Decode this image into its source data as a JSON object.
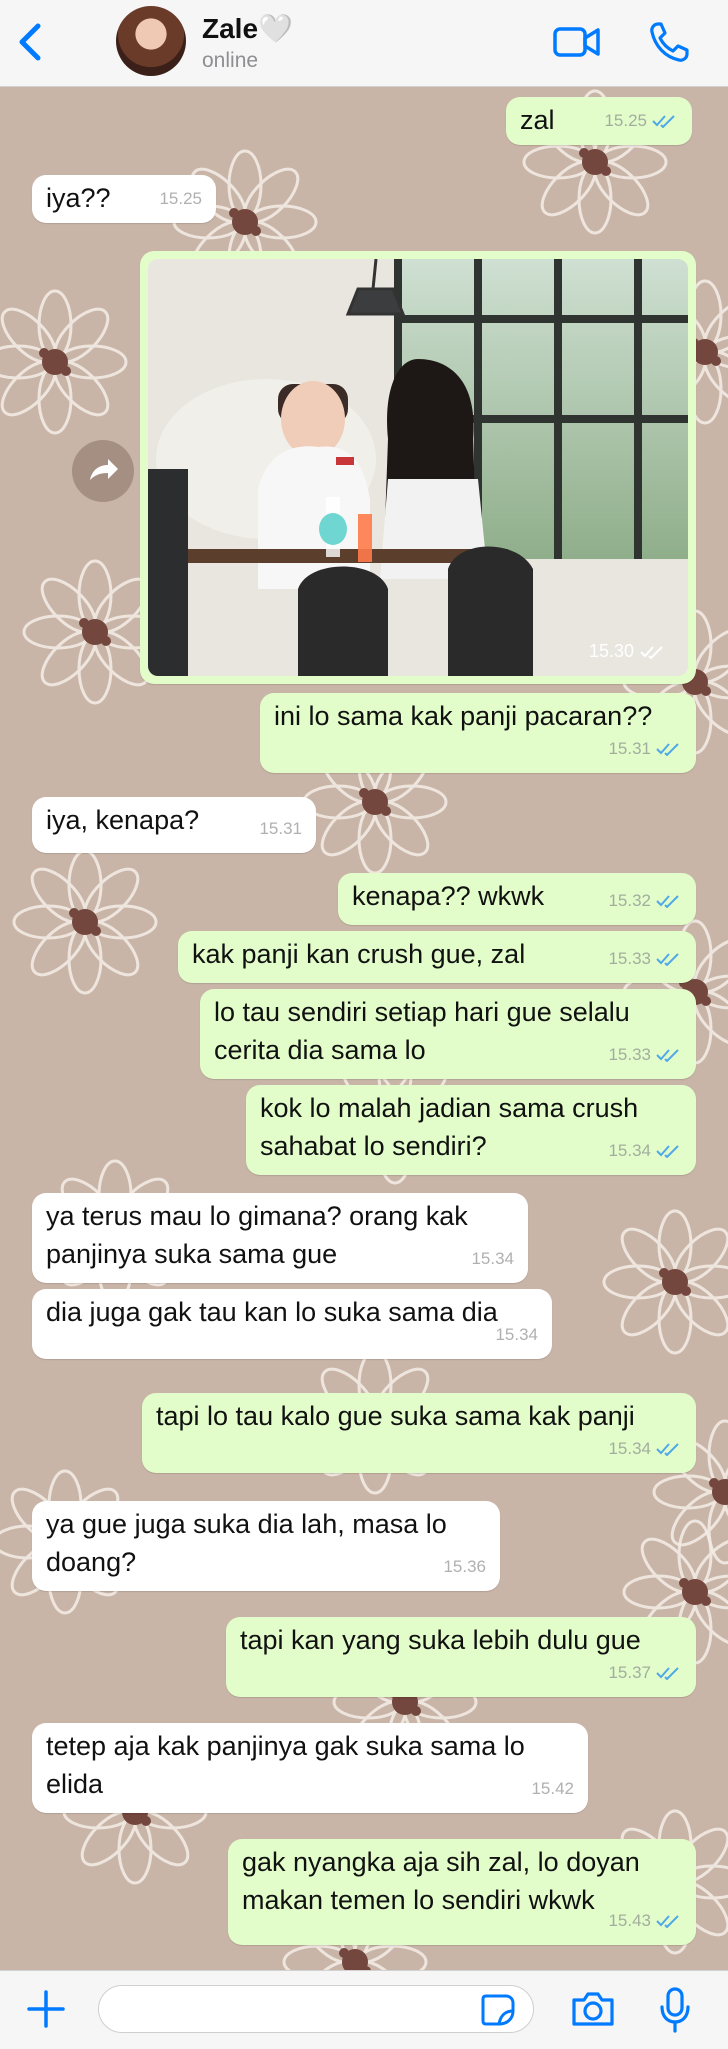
{
  "header": {
    "contact_name": "Zale🤍",
    "status": "online",
    "icons": [
      "back-arrow-icon",
      "video-call-icon",
      "phone-call-icon"
    ],
    "accent_color": "#007aff"
  },
  "photo_message": {
    "time": "15.30",
    "icons": [
      "forward-icon",
      "read-ticks-icon"
    ]
  },
  "messages": [
    {
      "dir": "out",
      "text": "zal",
      "time": "15.25"
    },
    {
      "dir": "in",
      "text": "iya??",
      "time": "15.25"
    },
    {
      "dir": "out",
      "text": "ini lo sama kak panji pacaran??",
      "time": "15.31"
    },
    {
      "dir": "in",
      "text": "iya, kenapa?",
      "time": "15.31"
    },
    {
      "dir": "out",
      "text": "kenapa?? wkwk",
      "time": "15.32"
    },
    {
      "dir": "out",
      "text": "kak panji kan crush gue, zal",
      "time": "15.33"
    },
    {
      "dir": "out",
      "text": "lo tau sendiri setiap hari gue selalu\ncerita dia sama lo",
      "time": "15.33"
    },
    {
      "dir": "out",
      "text": "kok lo malah jadian sama crush\nsahabat lo sendiri?",
      "time": "15.34"
    },
    {
      "dir": "in",
      "text": "ya terus mau lo gimana? orang kak\npanjinya suka sama gue",
      "time": "15.34"
    },
    {
      "dir": "in",
      "text": "dia juga gak tau kan lo suka sama dia",
      "time": "15.34"
    },
    {
      "dir": "out",
      "text": "tapi lo tau kalo gue suka sama kak panji",
      "time": "15.34"
    },
    {
      "dir": "in",
      "text": "ya gue juga suka dia lah, masa lo\ndoang?",
      "time": "15.36"
    },
    {
      "dir": "out",
      "text": "tapi kan yang suka lebih dulu gue",
      "time": "15.37"
    },
    {
      "dir": "in",
      "text": "tetep aja kak panjinya gak suka sama lo\nelida",
      "time": "15.42"
    },
    {
      "dir": "out",
      "text": "gak nyangka aja sih zal, lo doyan\nmakan temen lo sendiri wkwk",
      "time": "15.43"
    }
  ],
  "input_bar": {
    "placeholder": "",
    "icons": [
      "plus-icon",
      "sticker-icon",
      "camera-icon",
      "microphone-icon"
    ]
  },
  "colors": {
    "outgoing": "#e2fdca",
    "incoming": "#ffffff",
    "wallpaper": "#c9b5a7",
    "tick": "#4fa9e8"
  }
}
